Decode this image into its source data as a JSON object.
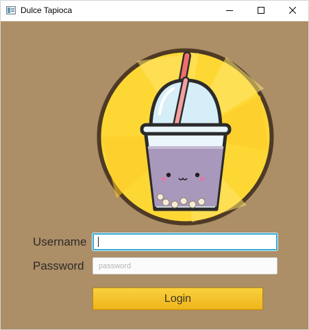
{
  "window": {
    "title": "Dulce Tapioca",
    "icon": "app-window-icon",
    "controls": {
      "minimize_icon": "minimize-icon",
      "maximize_icon": "maximize-icon",
      "close_icon": "close-icon"
    }
  },
  "logo": {
    "icon": "bubble-tea-logo",
    "label": ""
  },
  "form": {
    "username_label": "Username",
    "username_value": "",
    "username_placeholder": "",
    "password_label": "Password",
    "password_value": "",
    "password_placeholder": "password",
    "login_label": "Login"
  },
  "colors": {
    "background": "#ac8e67",
    "logo_yellow": "#fdd835",
    "logo_ring": "#4e3a26",
    "tea": "#a898bb",
    "straw": "#f26d6d",
    "button": "#f2bb22",
    "focus": "#35a9d6"
  }
}
